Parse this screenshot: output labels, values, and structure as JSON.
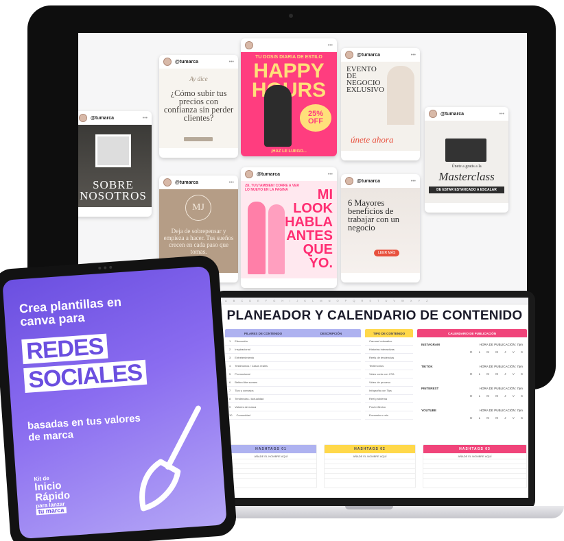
{
  "monitor": {
    "posts": [
      {
        "handle": "@tumarca",
        "text": "SOBRE NOSOTROS"
      },
      {
        "handle": "@tumarca",
        "script": "Ay dice",
        "text": "¿Cómo subir tus precios con confianza sin perder clientes?"
      },
      {
        "handle": "@tumarca",
        "text": "Deja de sobrepensar y empieza a hacer. Tus sueños crecen en cada paso que tomas.",
        "logo": "MJ"
      },
      {
        "handle": "",
        "top": "TU DOSIS DIARIA DE ESTILO",
        "big": "HAPPY HOURS",
        "offer": "25% OFF",
        "foot": "¡HAZ LE LUEGO..."
      },
      {
        "handle": "@tumarca",
        "top": "¡SI, TU!¡TAMBIEN! CORRE A VER LO NUEVO EN LA PAGINA",
        "big": "MI LOOK HABLA ANTES QUE YO."
      },
      {
        "handle": "@tumarca",
        "text": "EVENTO DE NEGOCIO EXLUSIVO",
        "cta": "únete ahora"
      },
      {
        "handle": "@tumarca",
        "text": "6 Mayores beneficios de trabajar con un negocio",
        "cta": "LEER MÁS"
      },
      {
        "handle": "@tumarca",
        "sub": "Únete a gratis a la",
        "text": "Masterclass",
        "foot": "DE ESTAR ESTANCADO A ESCALAR"
      }
    ]
  },
  "tablet": {
    "headline": "Crea plantillas en canva para",
    "badge1": "REDES",
    "badge2": "SOCIALES",
    "subtitle": "basadas en tus valores de marca",
    "kit_small": "Kit de",
    "kit_big1": "Inicio",
    "kit_big2": "Rápido",
    "kit_small2": "para lanzar",
    "kit_tag": "tu marca"
  },
  "laptop": {
    "title": "PLANEADOR Y CALENDARIO DE CONTENIDO",
    "pilares": {
      "header1": "PILARES DE CONTENIDO",
      "header2": "DESCRIPCIÓN",
      "rows": [
        "Educación",
        "Inspiracional",
        "Entretenimiento",
        "Testimonios / Casos reales",
        "Promocional",
        "Behind the scenes",
        "Tips y consejos",
        "Tendencias / Actualidad",
        "Valores de marca",
        "Comunidad"
      ]
    },
    "tipo": {
      "header": "TIPO DE CONTENIDO",
      "rows": [
        "Carrusel educativo",
        "Historias interactivas",
        "Reels de tendencias",
        "Testimonios",
        "Video corto con CTA",
        "Video de proceso",
        "Infografía con Tips",
        "Reel problema",
        "Post reflexivo",
        "Encuesta o reto"
      ]
    },
    "calendario": {
      "header": "CALENDARIO DE PUBLICACIÓN",
      "channels": [
        {
          "name": "INSTAGRAM",
          "hora": "HORA DE PUBLICACIÓN: 7pm"
        },
        {
          "name": "TIKTOK",
          "hora": "HORA DE PUBLICACIÓN: 7pm"
        },
        {
          "name": "PINTEREST",
          "hora": "HORA DE PUBLICACIÓN: 7pm"
        },
        {
          "name": "YOUTUBE",
          "hora": "HORA DE PUBLICACIÓN: 7pm"
        }
      ],
      "days": "D L M M J V S"
    },
    "hashtags": [
      {
        "title": "HASHTAGS 01",
        "note": "AÑADE EL NOMBRE AQUÍ"
      },
      {
        "title": "HASHTAGS 02",
        "note": "AÑADE EL NOMBRE AQUÍ"
      },
      {
        "title": "HASHTAGS 03",
        "note": "AÑADE EL NOMBRE AQUÍ"
      }
    ]
  },
  "colors": {
    "purple": "#6b4fe0",
    "pink": "#f0447a",
    "yellow": "#ffd84a",
    "lavender": "#aeb2f0"
  }
}
